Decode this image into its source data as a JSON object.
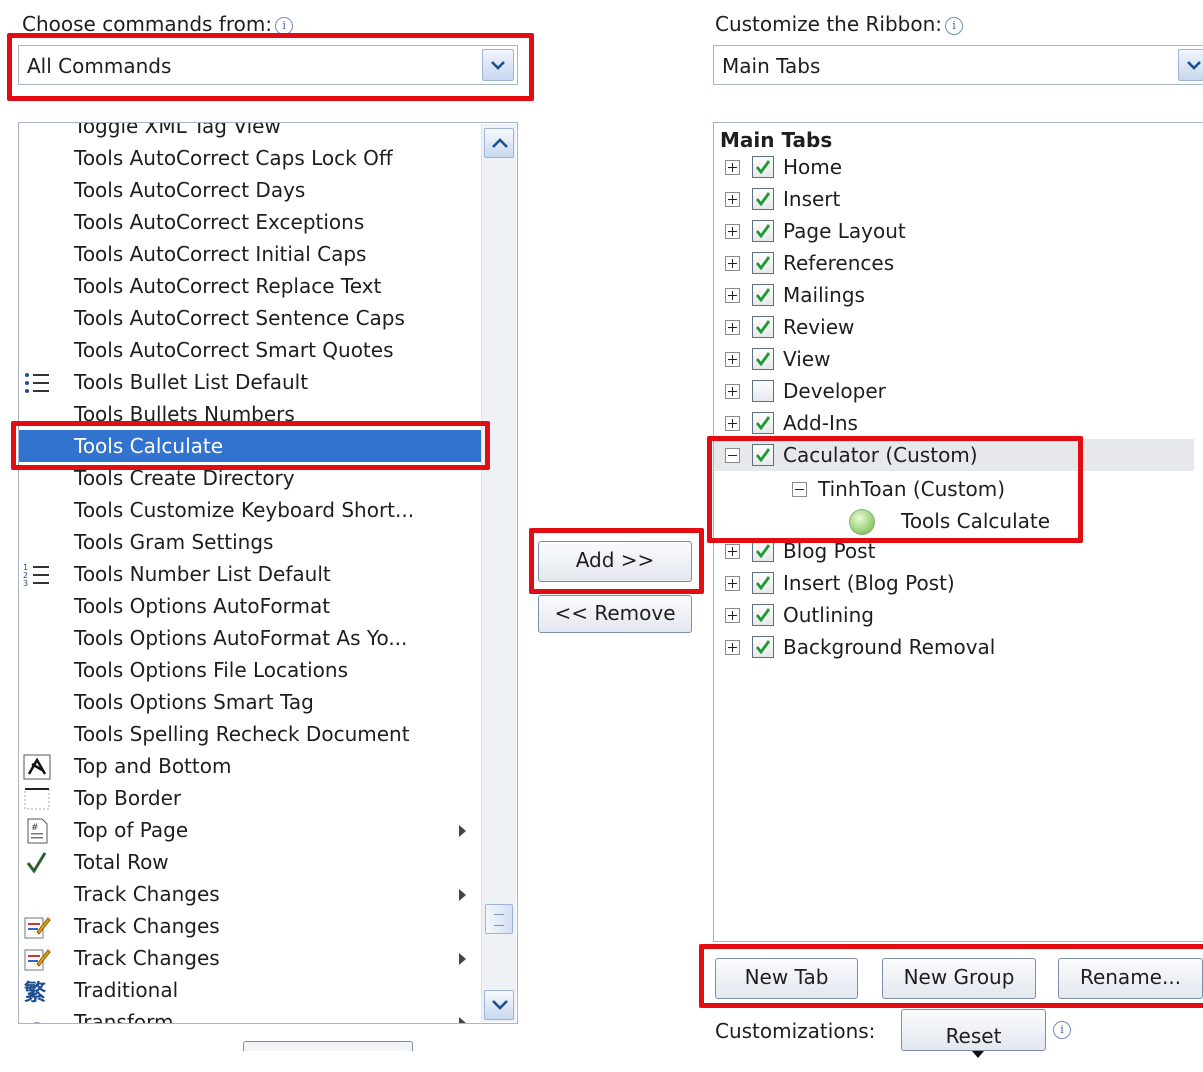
{
  "left": {
    "label": "Choose commands from:",
    "info_icon": "i",
    "combo_value": "All Commands",
    "list_items": [
      {
        "text": "Toggle XML Tag View",
        "icon": ""
      },
      {
        "text": "Tools AutoCorrect Caps Lock Off",
        "icon": ""
      },
      {
        "text": "Tools AutoCorrect Days",
        "icon": ""
      },
      {
        "text": "Tools AutoCorrect Exceptions",
        "icon": ""
      },
      {
        "text": "Tools AutoCorrect Initial Caps",
        "icon": ""
      },
      {
        "text": "Tools AutoCorrect Replace Text",
        "icon": ""
      },
      {
        "text": "Tools AutoCorrect Sentence Caps",
        "icon": ""
      },
      {
        "text": "Tools AutoCorrect Smart Quotes",
        "icon": ""
      },
      {
        "text": "Tools Bullet List Default",
        "icon": "bullet-list-icon"
      },
      {
        "text": "Tools Bullets Numbers",
        "icon": ""
      },
      {
        "text": "Tools Calculate",
        "icon": "",
        "selected": true
      },
      {
        "text": "Tools Create Directory",
        "icon": ""
      },
      {
        "text": "Tools Customize Keyboard Short...",
        "icon": ""
      },
      {
        "text": "Tools Gram Settings",
        "icon": ""
      },
      {
        "text": "Tools Number List Default",
        "icon": "numbered-list-icon"
      },
      {
        "text": "Tools Options AutoFormat",
        "icon": ""
      },
      {
        "text": "Tools Options AutoFormat As Yo...",
        "icon": ""
      },
      {
        "text": "Tools Options File Locations",
        "icon": ""
      },
      {
        "text": "Tools Options Smart Tag",
        "icon": ""
      },
      {
        "text": "Tools Spelling Recheck Document",
        "icon": ""
      },
      {
        "text": "Top and Bottom",
        "icon": "wrap-top-bottom-icon"
      },
      {
        "text": "Top Border",
        "icon": "top-border-icon"
      },
      {
        "text": "Top of Page",
        "icon": "page-number-icon",
        "submenu": true
      },
      {
        "text": "Total Row",
        "icon": "checkmark-icon"
      },
      {
        "text": "Track Changes",
        "icon": "",
        "submenu": true
      },
      {
        "text": "Track Changes",
        "icon": "track-changes-icon"
      },
      {
        "text": "Track Changes",
        "icon": "track-changes-icon",
        "submenu": true
      },
      {
        "text": "Traditional",
        "icon": "traditional-chinese-icon"
      },
      {
        "text": "Transform",
        "icon": "transform-icon",
        "submenu": true
      }
    ]
  },
  "middle": {
    "add_label": "Add >>",
    "remove_label": "<< Remove"
  },
  "right": {
    "label": "Customize the Ribbon:",
    "info_icon": "i",
    "combo_value": "Main Tabs",
    "tree_header": "Main Tabs",
    "tabs": [
      {
        "text": "Home",
        "checked": true,
        "expanded": false
      },
      {
        "text": "Insert",
        "checked": true,
        "expanded": false
      },
      {
        "text": "Page Layout",
        "checked": true,
        "expanded": false
      },
      {
        "text": "References",
        "checked": true,
        "expanded": false
      },
      {
        "text": "Mailings",
        "checked": true,
        "expanded": false
      },
      {
        "text": "Review",
        "checked": true,
        "expanded": false
      },
      {
        "text": "View",
        "checked": true,
        "expanded": false
      },
      {
        "text": "Developer",
        "checked": false,
        "expanded": false
      },
      {
        "text": "Add-Ins",
        "checked": true,
        "expanded": false
      },
      {
        "text": "Caculator (Custom)",
        "checked": true,
        "expanded": true
      },
      {
        "text": "Blog Post",
        "checked": true,
        "expanded": false
      },
      {
        "text": "Insert (Blog Post)",
        "checked": true,
        "expanded": false
      },
      {
        "text": "Outlining",
        "checked": true,
        "expanded": false
      },
      {
        "text": "Background Removal",
        "checked": true,
        "expanded": false
      }
    ],
    "custom_group": "TinhToan (Custom)",
    "custom_command": "Tools Calculate",
    "new_tab_label": "New Tab",
    "new_group_label": "New Group",
    "rename_label": "Rename...",
    "customizations_label": "Customizations:",
    "reset_label": "Reset"
  },
  "colors": {
    "highlight_red": "#e20c12",
    "selection_blue": "#3173cf"
  }
}
